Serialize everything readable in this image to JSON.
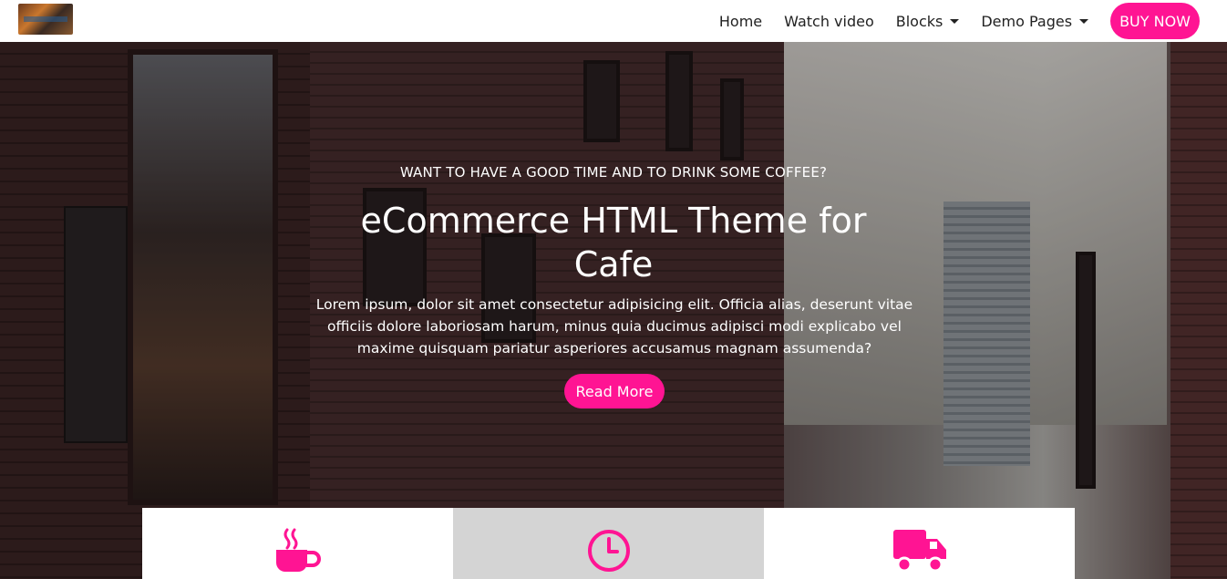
{
  "navbar": {
    "logo_icon": "cafe-logo-image",
    "links": [
      {
        "label": "Home"
      },
      {
        "label": "Watch video"
      },
      {
        "label": "Blocks",
        "dropdown": true
      },
      {
        "label": "Demo Pages",
        "dropdown": true
      }
    ],
    "cta_label": "BUY NOW"
  },
  "hero": {
    "kicker": "WANT TO HAVE A GOOD TIME AND TO DRINK SOME COFFEE?",
    "title": "eCommerce HTML Theme for Cafe",
    "text": "Lorem ipsum, dolor sit amet consectetur adipisicing elit. Officia alias, deserunt vitae officiis dolore laboriosam harum, minus quia ducimus adipisci modi explicabo vel maxime quisquam pariatur asperiores accusamus magnam assumenda?",
    "button_label": "Read More"
  },
  "features": [
    {
      "icon": "coffee-cup-icon"
    },
    {
      "icon": "clock-icon"
    },
    {
      "icon": "truck-icon"
    }
  ],
  "colors": {
    "accent": "#ff1493",
    "feature_active_bg": "#d4d4d4"
  }
}
